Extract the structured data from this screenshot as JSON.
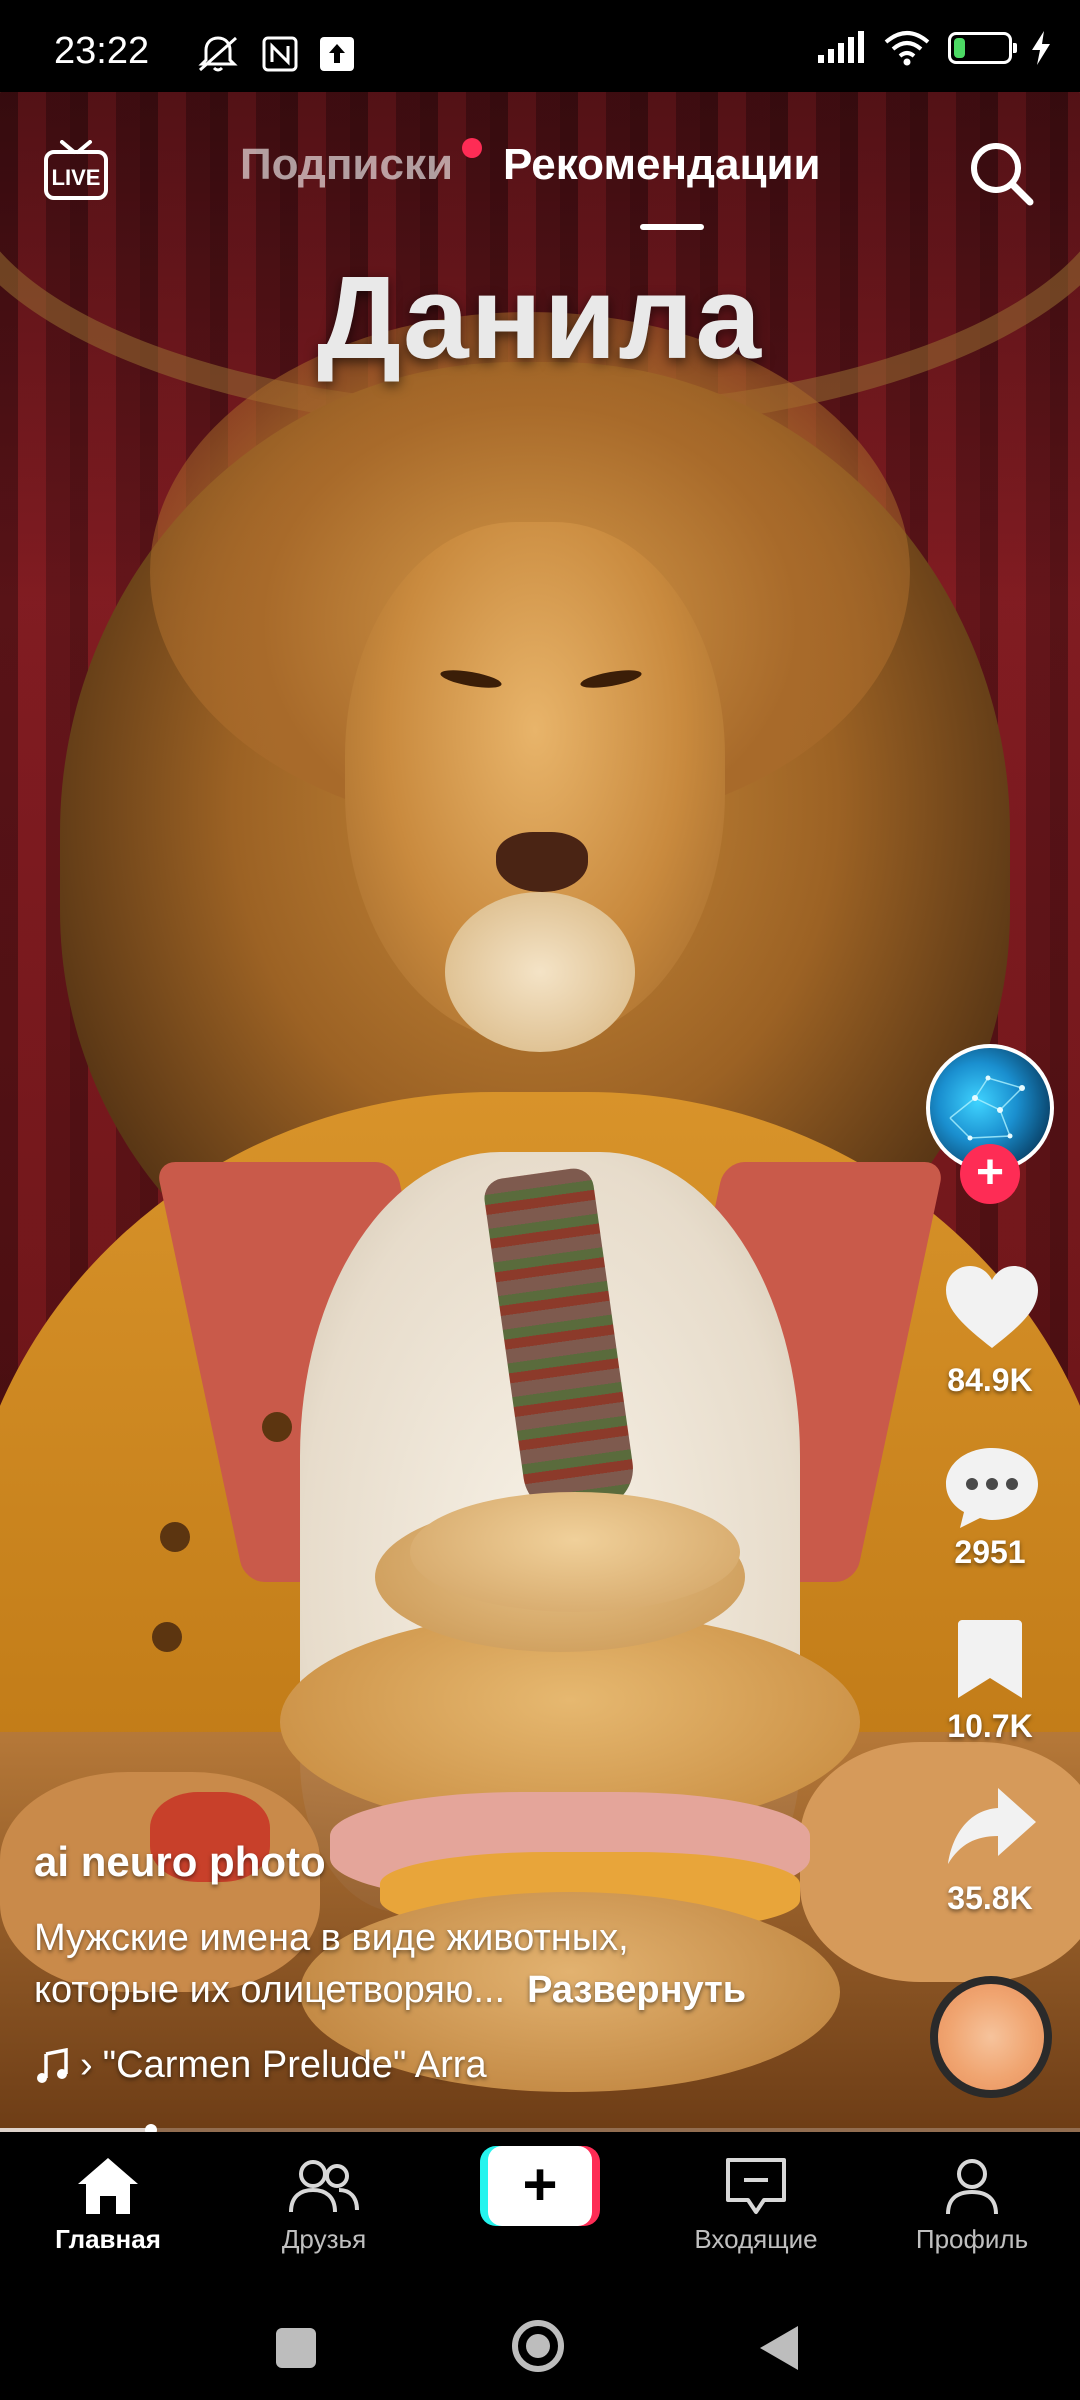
{
  "status_bar": {
    "time": "23:22",
    "battery_percent": "29",
    "battery_level": 0.29,
    "icons": [
      "mute-icon",
      "nfc-icon",
      "upload-icon",
      "signal-icon",
      "wifi-icon",
      "battery-icon",
      "charging-icon"
    ]
  },
  "top_bar": {
    "live_label": "LIVE",
    "tabs": [
      {
        "label": "Подписки",
        "active": false,
        "has_dot": true
      },
      {
        "label": "Рекомендации",
        "active": true,
        "has_dot": false
      }
    ],
    "search_icon": "search-icon"
  },
  "video": {
    "overlay_title": "Данила",
    "progress": 0.14
  },
  "actions": {
    "likes": "84.9K",
    "comments": "2951",
    "saves": "10.7K",
    "shares": "35.8K"
  },
  "post": {
    "author": "ai neuro photo",
    "caption_line1": "Мужские имена в виде животных,",
    "caption_line2": "которые их олицетворяю...",
    "expand_label": "Развернуть",
    "music": "\"Carmen Prelude\" Arra"
  },
  "bottom_nav": {
    "items": [
      {
        "label": "Главная",
        "icon": "home-icon",
        "active": true
      },
      {
        "label": "Друзья",
        "icon": "friends-icon",
        "active": false
      },
      {
        "label": "",
        "icon": "create-icon",
        "active": false
      },
      {
        "label": "Входящие",
        "icon": "inbox-icon",
        "active": false
      },
      {
        "label": "Профиль",
        "icon": "profile-icon",
        "active": false
      }
    ],
    "create_symbol": "+"
  },
  "colors": {
    "accent": "#fe2c55",
    "cyan": "#25f4ee",
    "battery": "#4cd964"
  }
}
